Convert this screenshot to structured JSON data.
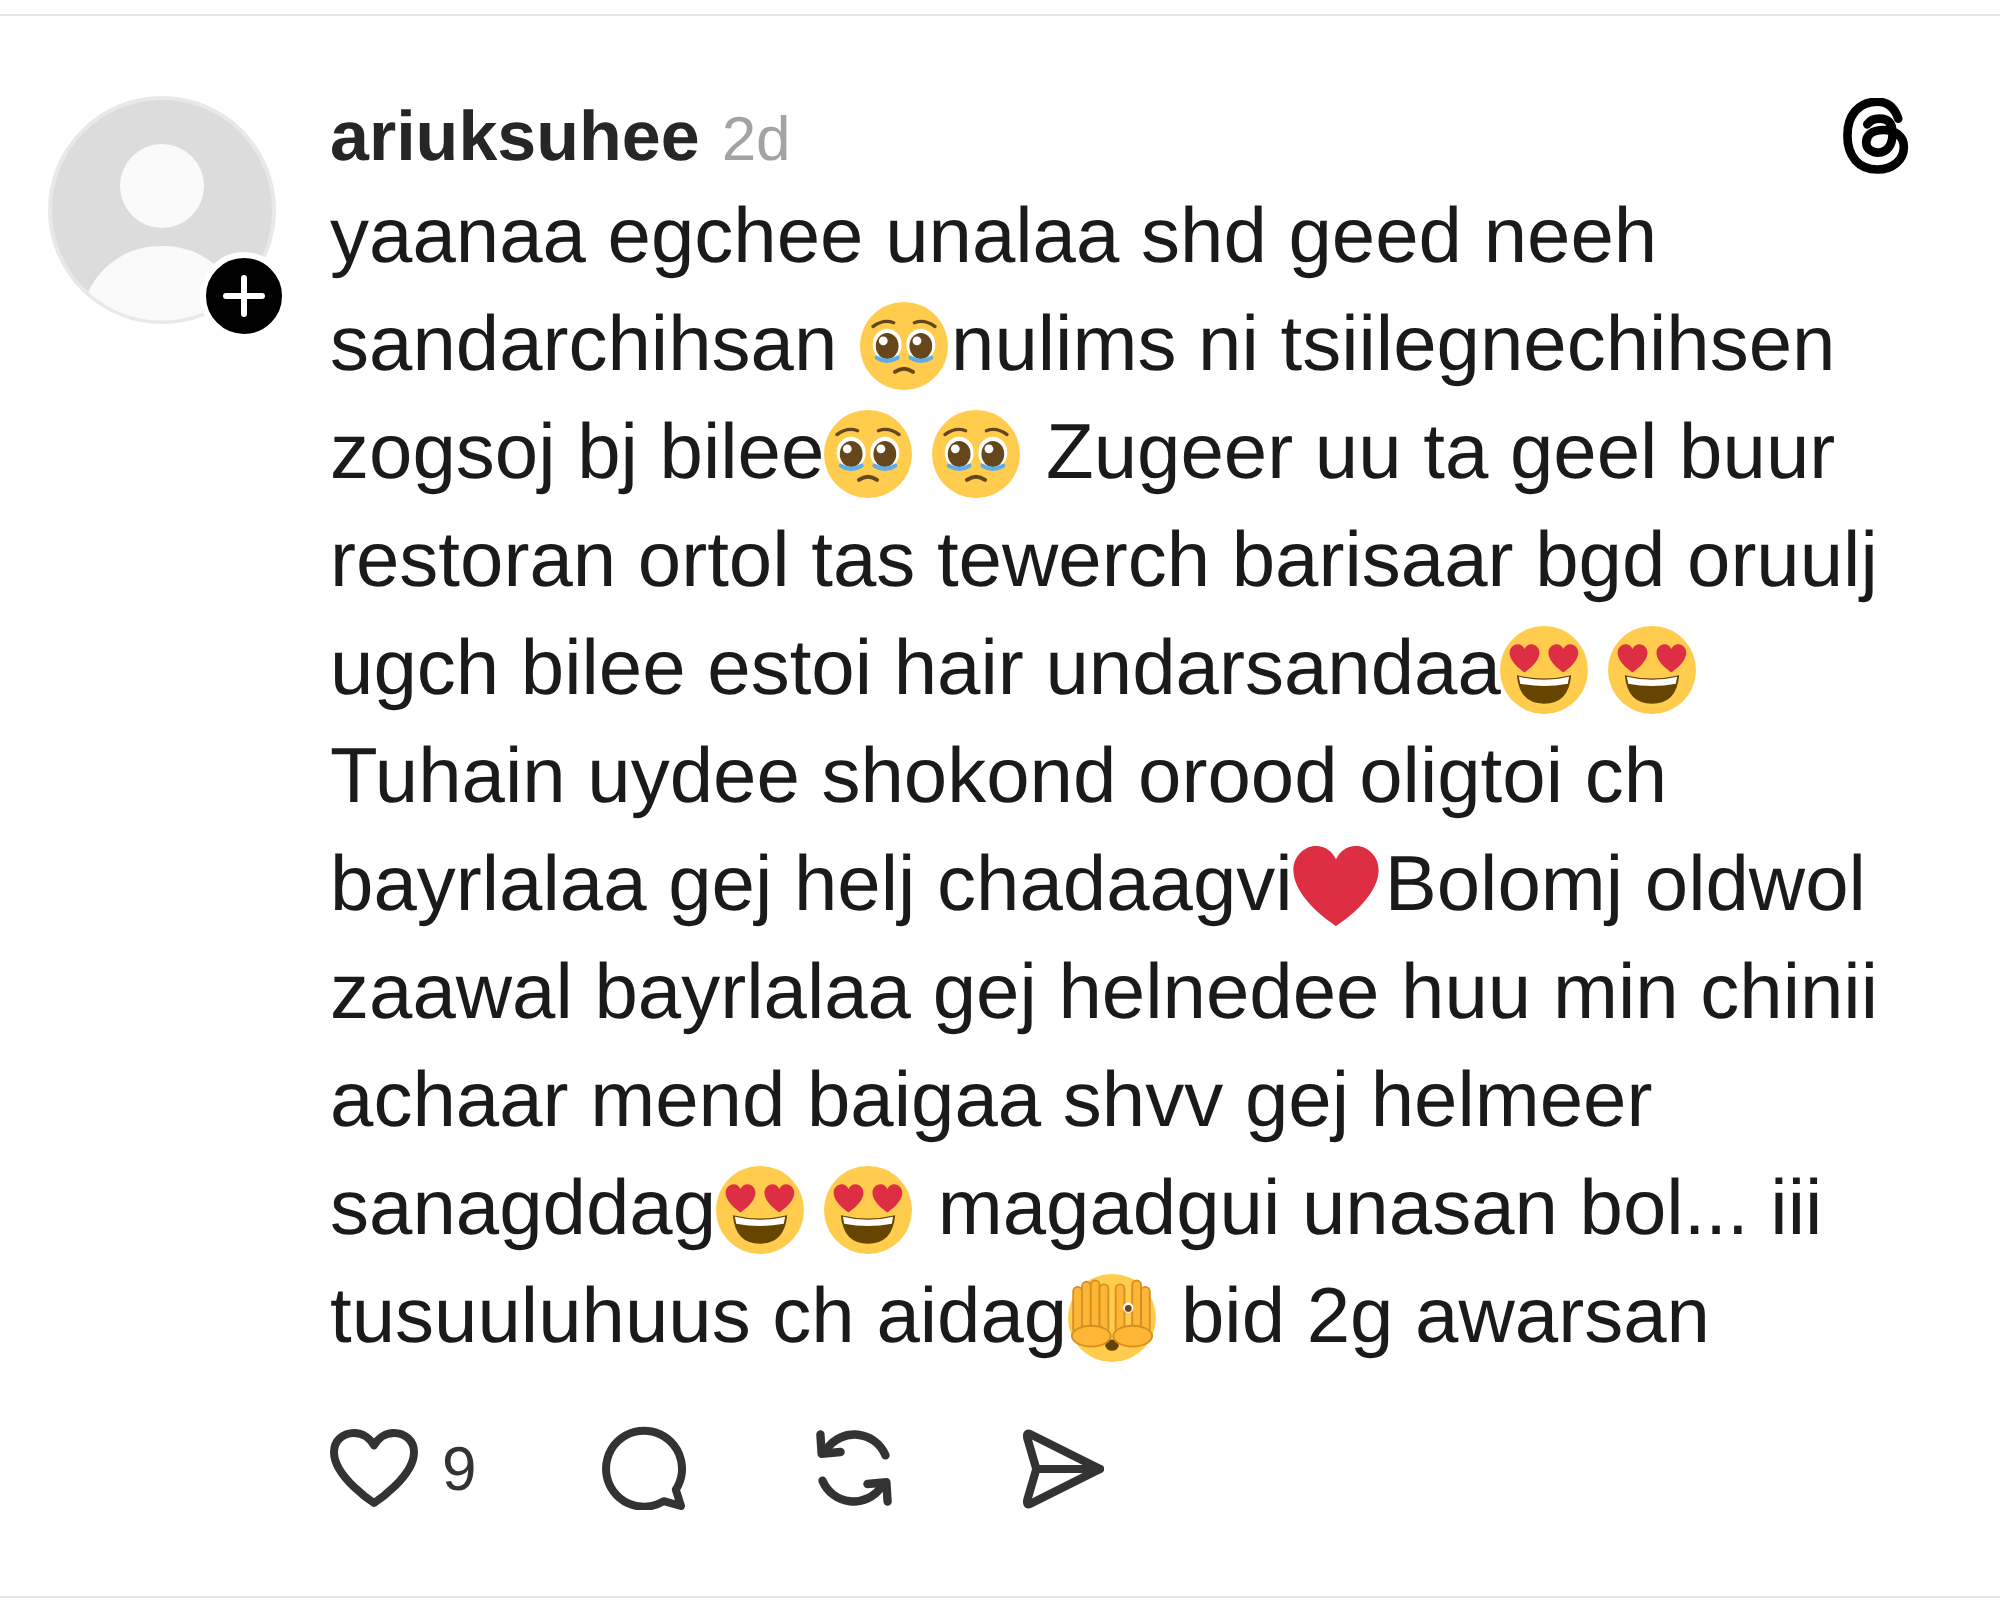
{
  "post": {
    "author": {
      "username": "ariuksuhee",
      "time": "2d"
    },
    "body": [
      [
        {
          "kind": "text",
          "text": "yaanaa egchee unalaa shd geed neeh"
        }
      ],
      [
        {
          "kind": "text",
          "text": "sandarchihsan "
        },
        {
          "kind": "pleading"
        },
        {
          "kind": "text",
          "text": "nulims ni tsiilegnechihsen"
        }
      ],
      [
        {
          "kind": "text",
          "text": "zogsoj bj bilee"
        },
        {
          "kind": "pleading"
        },
        {
          "kind": "pleading"
        },
        {
          "kind": "text",
          "text": " Zugeer uu ta geel buur"
        }
      ],
      [
        {
          "kind": "text",
          "text": "restoran ortol tas tewerch barisaar bgd oruulj"
        }
      ],
      [
        {
          "kind": "text",
          "text": "ugch bilee estoi hair undarsandaa"
        },
        {
          "kind": "hearteyes"
        },
        {
          "kind": "hearteyes"
        }
      ],
      [
        {
          "kind": "text",
          "text": "Tuhain uydee shokond orood oligtoi ch"
        }
      ],
      [
        {
          "kind": "text",
          "text": "bayrlalaa gej helj chadaagvi"
        },
        {
          "kind": "heart"
        },
        {
          "kind": "text",
          "text": "Bolomj oldwol"
        }
      ],
      [
        {
          "kind": "text",
          "text": "zaawal bayrlalaa gej helnedee huu min chinii"
        }
      ],
      [
        {
          "kind": "text",
          "text": "achaar mend baigaa shvv gej helmeer"
        }
      ],
      [
        {
          "kind": "text",
          "text": "sanagddag"
        },
        {
          "kind": "hearteyes"
        },
        {
          "kind": "hearteyes"
        },
        {
          "kind": "text",
          "text": " magadgui unasan bol... iii"
        }
      ],
      [
        {
          "kind": "text",
          "text": "tusuuluhuus ch aidag"
        },
        {
          "kind": "peeking"
        },
        {
          "kind": "text",
          "text": " bid 2g awarsan"
        }
      ]
    ],
    "actions": [
      {
        "kind": "like",
        "count": "9"
      },
      {
        "kind": "reply"
      },
      {
        "kind": "repost"
      },
      {
        "kind": "share"
      }
    ]
  }
}
